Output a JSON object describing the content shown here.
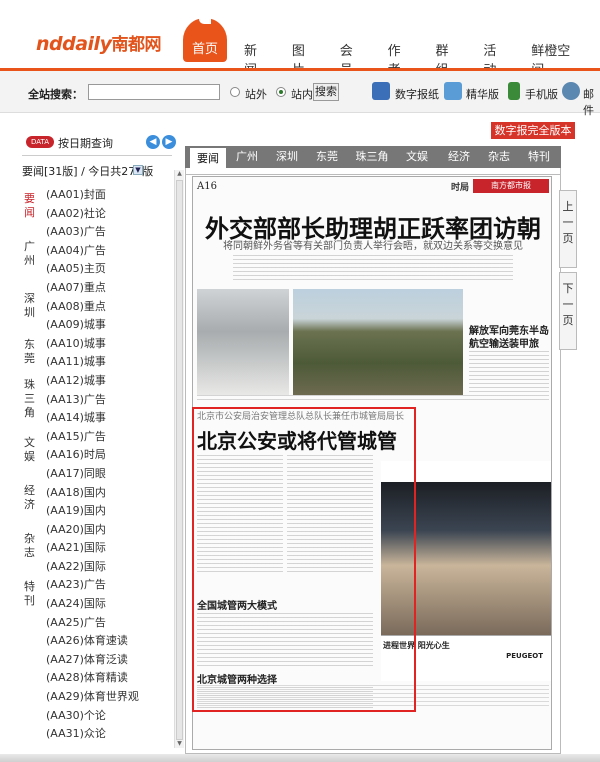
{
  "header": {
    "logo_en": "nddaily",
    "logo_cn": "南都网",
    "home_label": "首页",
    "nav": [
      "新闻",
      "图片",
      "会员",
      "作者",
      "群组",
      "活动",
      "鲜橙空间"
    ]
  },
  "search": {
    "label": "全站搜索：",
    "value": "",
    "placeholder": "",
    "option_outside": "站外",
    "option_inside": "站内",
    "selected": "站内",
    "button": "搜索"
  },
  "quick_links": [
    {
      "label": "数字报纸",
      "icon": "newspaper-icon",
      "color": "#3b6fb8"
    },
    {
      "label": "精华版",
      "icon": "monitor-icon",
      "color": "#5a9cd6"
    },
    {
      "label": "手机版",
      "icon": "phone-icon",
      "color": "#3a8a3a"
    },
    {
      "label": "邮件",
      "icon": "mail-icon",
      "color": "#5a88b0"
    }
  ],
  "digital_full_button": "数字报完全版本",
  "left_panel": {
    "badge": "DATA",
    "title": "按日期查询",
    "page_select": "要闻[31版] / 今日共279版",
    "categories": [
      "要闻",
      "广州",
      "深圳",
      "东莞",
      "珠三角",
      "文娱",
      "经济",
      "杂志",
      "特刊"
    ],
    "active_category": "要闻",
    "items": [
      "(AA01)封面",
      "(AA02)社论",
      "(AA03)广告",
      "(AA04)广告",
      "(AA05)主页",
      "(AA07)重点",
      "(AA08)重点",
      "(AA09)城事",
      "(AA10)城事",
      "(AA11)城事",
      "(AA12)城事",
      "(AA13)广告",
      "(AA14)城事",
      "(AA15)广告",
      "(AA16)时局",
      "(AA17)同眼",
      "(AA18)国内",
      "(AA19)国内",
      "(AA20)国内",
      "(AA21)国际",
      "(AA22)国际",
      "(AA23)广告",
      "(AA24)国际",
      "(AA25)广告",
      "(AA26)体育速读",
      "(AA27)体育泛读",
      "(AA28)体育精读",
      "(AA29)体育世界观",
      "(AA30)个论",
      "(AA31)众论"
    ]
  },
  "tabs": [
    "要闻",
    "广州",
    "深圳",
    "东莞",
    "珠三角",
    "文娱",
    "经济",
    "杂志",
    "特刊"
  ],
  "active_tab": "要闻",
  "paper": {
    "page": "A16",
    "masthead_left": "时局",
    "masthead": "南方都市报",
    "headline1": "外交部部长助理胡正跃率团访朝",
    "sub1": "将同朝鲜外务省等有关部门负责人举行会晤，就双边关系等交换意见",
    "side_title": "解放军向莞东半岛航空输送装甲旅",
    "kicker2": "北京市公安局治安管理总队总队长兼任市城管局局长",
    "headline2": "北京公安或将代管城管",
    "subhead1": "全国城管两大模式",
    "subhead2": "北京城管两种选择",
    "ad_footer": "进程世界 阳光心生",
    "ad_brand": "PEUGEOT"
  },
  "side_nav": {
    "prev": "上一页",
    "next": "下一页"
  }
}
